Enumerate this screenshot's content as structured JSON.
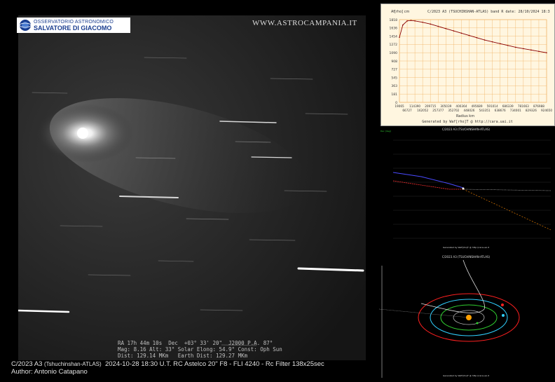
{
  "logo": {
    "line1": "OSSERVATORIO ASTRONOMICO",
    "line2": "SALVATORE DI GIACOMO",
    "emblem": "observatory-emblem-icon"
  },
  "site_url": "WWW.ASTROCAMPANIA.IT",
  "overlay": {
    "line1": "RA 17h 44m 10s  Dec  +03° 33' 20\"  J2000 P.A. 87°",
    "line2": "Mag: 8.16 Alt: 33° Solar Elong: 54.9° Const: Oph Sun",
    "line3": "Dist: 129.14 MKm   Earth Dist: 129.27 MKm"
  },
  "caption": {
    "title": "C/2023 A3",
    "title_small": "(Tshuchinshan-ATLAS)",
    "details": "2024-10-28  18:30 U.T.  RC Astelco 20\" F8 - FLI 4240 - Rc Filter 138x25sec",
    "author": "Author: Antonio Catapano"
  },
  "profile_panel": {
    "title": "C/2023 A3 (TSUCHINSHAN-ATLAS) band R date: 28/10/2024 18:3",
    "ylabel_tag": "Af[rho] cm",
    "xlabel": "Radius km",
    "credit": "Generated by Waf[rho]T @ http://cara.uai.it",
    "chart_data": {
      "type": "line",
      "title": "C/2023 A3 (TSUCHINSHAN-ATLAS) band R date: 28/10/2024 18:3",
      "xlabel": "Radius km",
      "ylabel": "Af[rho] cm",
      "y_ticks": [
        "1818",
        "1636",
        "1454",
        "1272",
        "1090",
        "908",
        "727",
        "545",
        "363",
        "181",
        "0"
      ],
      "x_ticks_top": [
        "19065",
        "114390",
        "209715",
        "305039",
        "400364",
        "495689",
        "591014",
        "686339",
        "781663",
        "876988"
      ],
      "x_ticks_bottom": [
        "66727",
        "162052",
        "257377",
        "352702",
        "448026",
        "543351",
        "638676",
        "734001",
        "829326",
        "924650"
      ],
      "ylim": [
        0,
        1818
      ],
      "series": [
        {
          "x": [
            19065,
            40000,
            66727,
            90000,
            114390,
            162052,
            209715,
            257377,
            305039,
            352702,
            400364,
            448026,
            495689,
            543351,
            591014,
            638676,
            686339,
            734001,
            781663,
            829326,
            876988,
            924650
          ],
          "values": [
            1430,
            1700,
            1790,
            1800,
            1790,
            1760,
            1720,
            1670,
            1620,
            1570,
            1520,
            1470,
            1420,
            1370,
            1330,
            1290,
            1250,
            1210,
            1180,
            1150,
            1120,
            1090
          ]
        }
      ],
      "grid": true
    }
  },
  "orbit_panel": {
    "title": "C/2023 A3 (TSUCHINSHAN-ATLAS)",
    "credit": "Generated by WaF[rho]T @ http://cara.uai.it"
  },
  "solar_panel": {
    "title": "C/2023 A3 (TSUCHINSHAN-ATLAS)",
    "credit": "Generated by WaF[rho]T @ http://cara.uai.it"
  },
  "colors": {
    "profile_bg": "#fff6e0",
    "profile_line": "#8b0000",
    "grid": "#f0b060",
    "orbit_red": "#ff2020",
    "orbit_green": "#30d030",
    "orbit_cyan": "#30d0ff",
    "sun": "#ffa000"
  }
}
